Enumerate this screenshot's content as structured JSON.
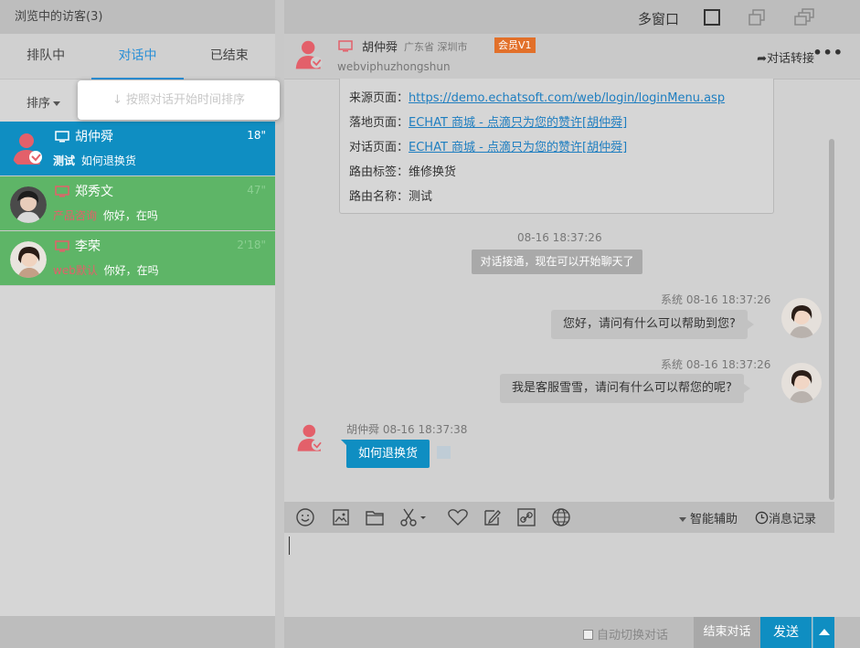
{
  "left_panel": {
    "title": "浏览中的访客(3)",
    "tabs": [
      {
        "label": "排队中"
      },
      {
        "label": "对话中"
      },
      {
        "label": "已结束"
      }
    ],
    "sort_label": "排序",
    "sort_tooltip": "↓  按照对话开始时间排序",
    "visitors": [
      {
        "name": "胡仲舜",
        "time": "18\"",
        "tag": "测试",
        "message": "如何退换货"
      },
      {
        "name": "郑秀文",
        "time": "47\"",
        "tag": "产品咨询",
        "message": "你好，在吗"
      },
      {
        "name": "李荣",
        "time": "2'18\"",
        "tag": "web默认",
        "message": "你好，在吗"
      }
    ]
  },
  "topbar": {
    "multi_window": "多窗口"
  },
  "chat_header": {
    "name": "胡仲舜",
    "location": "广东省 深圳市",
    "vip_badge": "会员V1",
    "visitor_id": "webviphuzhongshun",
    "transfer_label": "对话转接",
    "more_label": "•••"
  },
  "info": {
    "rows": [
      {
        "label": "来源页面：",
        "value": "https://demo.echatsoft.com/web/login/loginMenu.asp"
      },
      {
        "label": "落地页面：",
        "value": "ECHAT 商城 - 点滴只为您的赞许[胡仲舜]"
      },
      {
        "label": "对话页面：",
        "value": "ECHAT 商城 - 点滴只为您的赞许[胡仲舜]"
      },
      {
        "label": "路由标签：",
        "value": "维修换货"
      },
      {
        "label": "路由名称：",
        "value": "测试"
      }
    ]
  },
  "messages": {
    "system_time": "08-16 18:37:26",
    "system_note": "对话接通，现在可以开始聊天了",
    "agent1_meta": "系统  08-16 18:37:26",
    "agent1_text": "您好，请问有什么可以帮助到您?",
    "agent2_meta": "系统  08-16 18:37:26",
    "agent2_text": "我是客服雪雪，请问有什么可以帮您的呢?",
    "visitor_meta": "胡仲舜  08-16 18:37:38",
    "visitor_text": "如何退换货"
  },
  "toolbar": {
    "assist_label": "智能辅助",
    "history_label": "消息记录"
  },
  "footer": {
    "auto_switch": "自动切换对话",
    "end_chat": "结束对话",
    "send": "发送"
  },
  "colors": {
    "accent": "#0f8ec2",
    "green_item": "#5eb567",
    "vip": "#e2702a",
    "visitor_icon": "#e3606a"
  }
}
